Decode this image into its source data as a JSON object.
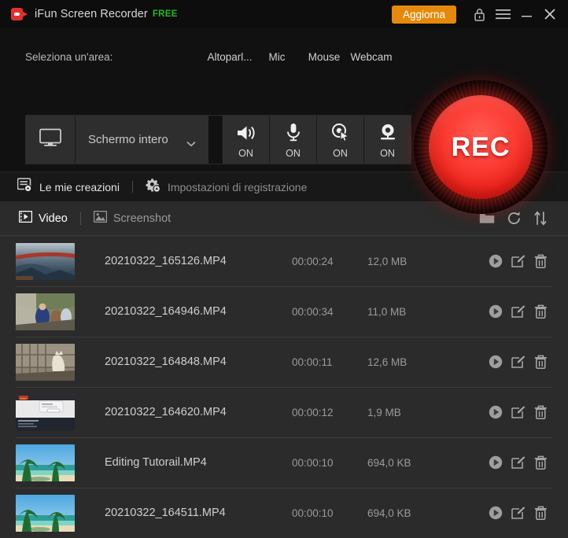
{
  "titlebar": {
    "logo_icon": "camcorder-icon",
    "app_name": "iFun Screen Recorder",
    "edition_badge": "FREE",
    "upgrade_label": "Aggiorna",
    "lock_icon": "lock-icon",
    "menu_icon": "hamburger-menu-icon",
    "minimize_icon": "minimize-icon",
    "close_icon": "close-icon",
    "accent_orange": "#e4890d",
    "brand_red": "#e0302e",
    "free_green": "#29b529"
  },
  "control_panel": {
    "area_label": "Seleziona un'area:",
    "screen_icon": "monitor-icon",
    "area_value": "Schermo intero",
    "chevron_icon": "chevron-down-icon",
    "devices": [
      {
        "label": "Altoparl...",
        "icon": "speaker-icon",
        "state": "ON"
      },
      {
        "label": "Mic",
        "icon": "microphone-icon",
        "state": "ON"
      },
      {
        "label": "Mouse",
        "icon": "mouse-click-icon",
        "state": "ON"
      },
      {
        "label": "Webcam",
        "icon": "webcam-icon",
        "state": "ON"
      }
    ],
    "rec_label": "REC",
    "rec_color": "#e62319"
  },
  "subbar": {
    "creations_icon": "my-creations-icon",
    "creations_label": "Le mie creazioni",
    "settings_icon": "gear-icon",
    "settings_label": "Impostazioni di registrazione"
  },
  "tabs": {
    "video": {
      "label": "Video",
      "icon": "film-icon"
    },
    "screenshot": {
      "label": "Screenshot",
      "icon": "image-icon"
    },
    "actions": [
      {
        "name": "open-folder",
        "icon": "folder-icon"
      },
      {
        "name": "refresh",
        "icon": "refresh-icon"
      },
      {
        "name": "sort",
        "icon": "sort-icon"
      }
    ]
  },
  "file_list": {
    "row_actions": [
      "play-icon",
      "edit-icon",
      "delete-icon"
    ],
    "rows": [
      {
        "name": "20210322_165126.MP4",
        "duration": "00:00:24",
        "size": "12,0 MB",
        "thumb": "bridge-over-valley"
      },
      {
        "name": "20210322_164946.MP4",
        "duration": "00:00:34",
        "size": "11,0 MB",
        "thumb": "people-outdoors"
      },
      {
        "name": "20210322_164848.MP4",
        "duration": "00:00:11",
        "size": "12,6 MB",
        "thumb": "wolf-in-enclosure"
      },
      {
        "name": "20210322_164620.MP4",
        "duration": "00:00:12",
        "size": "1,9 MB",
        "thumb": "laptop-screenshot"
      },
      {
        "name": "Editing Tutorail.MP4",
        "duration": "00:00:10",
        "size": "694,0 KB",
        "thumb": "tropical-beach"
      },
      {
        "name": "20210322_164511.MP4",
        "duration": "00:00:10",
        "size": "694,0 KB",
        "thumb": "tropical-beach"
      }
    ]
  }
}
